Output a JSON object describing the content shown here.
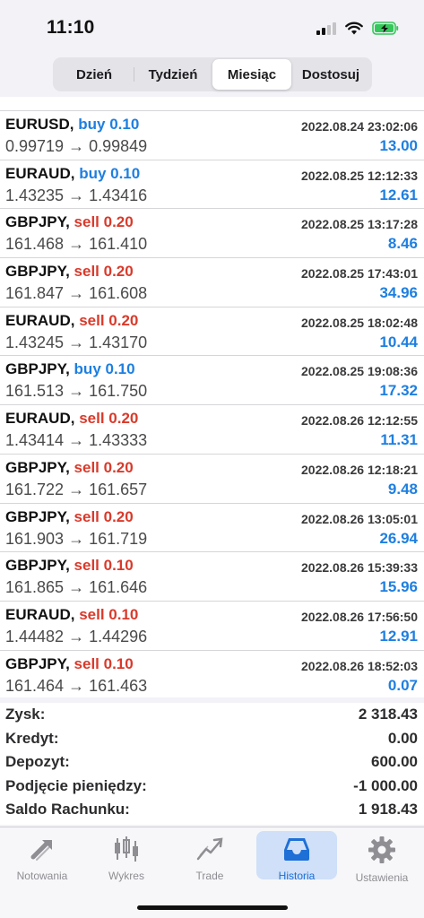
{
  "status": {
    "time": "11:10"
  },
  "period_tabs": [
    {
      "label": "Dzień",
      "active": false
    },
    {
      "label": "Tydzień",
      "active": false
    },
    {
      "label": "Miesiąc",
      "active": true
    },
    {
      "label": "Dostosuj",
      "active": false
    }
  ],
  "colors": {
    "buy": "#1e7fe0",
    "sell": "#d93a2b",
    "profit": "#1e7fe0",
    "tab_active_bg": "#cfe0f8"
  },
  "trades": [
    {
      "symbol": "EURUSD,",
      "side": "buy 0.10",
      "type": "buy",
      "date": "2022.08.24 23:02:06",
      "prices": "0.99719 → 0.99849",
      "profit": "13.00"
    },
    {
      "symbol": "EURAUD,",
      "side": "buy 0.10",
      "type": "buy",
      "date": "2022.08.25 12:12:33",
      "prices": "1.43235 → 1.43416",
      "profit": "12.61"
    },
    {
      "symbol": "GBPJPY,",
      "side": "sell 0.20",
      "type": "sell",
      "date": "2022.08.25 13:17:28",
      "prices": "161.468 → 161.410",
      "profit": "8.46"
    },
    {
      "symbol": "GBPJPY,",
      "side": "sell 0.20",
      "type": "sell",
      "date": "2022.08.25 17:43:01",
      "prices": "161.847 → 161.608",
      "profit": "34.96"
    },
    {
      "symbol": "EURAUD,",
      "side": "sell 0.20",
      "type": "sell",
      "date": "2022.08.25 18:02:48",
      "prices": "1.43245 → 1.43170",
      "profit": "10.44"
    },
    {
      "symbol": "GBPJPY,",
      "side": "buy 0.10",
      "type": "buy",
      "date": "2022.08.25 19:08:36",
      "prices": "161.513 → 161.750",
      "profit": "17.32"
    },
    {
      "symbol": "EURAUD,",
      "side": "sell 0.20",
      "type": "sell",
      "date": "2022.08.26 12:12:55",
      "prices": "1.43414 → 1.43333",
      "profit": "11.31"
    },
    {
      "symbol": "GBPJPY,",
      "side": "sell 0.20",
      "type": "sell",
      "date": "2022.08.26 12:18:21",
      "prices": "161.722 → 161.657",
      "profit": "9.48"
    },
    {
      "symbol": "GBPJPY,",
      "side": "sell 0.20",
      "type": "sell",
      "date": "2022.08.26 13:05:01",
      "prices": "161.903 → 161.719",
      "profit": "26.94"
    },
    {
      "symbol": "GBPJPY,",
      "side": "sell 0.10",
      "type": "sell",
      "date": "2022.08.26 15:39:33",
      "prices": "161.865 → 161.646",
      "profit": "15.96"
    },
    {
      "symbol": "EURAUD,",
      "side": "sell 0.10",
      "type": "sell",
      "date": "2022.08.26 17:56:50",
      "prices": "1.44482 → 1.44296",
      "profit": "12.91"
    },
    {
      "symbol": "GBPJPY,",
      "side": "sell 0.10",
      "type": "sell",
      "date": "2022.08.26 18:52:03",
      "prices": "161.464 → 161.463",
      "profit": "0.07"
    }
  ],
  "summary": [
    {
      "label": "Zysk:",
      "value": "2 318.43"
    },
    {
      "label": "Kredyt:",
      "value": "0.00"
    },
    {
      "label": "Depozyt:",
      "value": "600.00"
    },
    {
      "label": "Podjęcie pieniędzy:",
      "value": "-1 000.00"
    },
    {
      "label": "Saldo Rachunku:",
      "value": "1 918.43"
    }
  ],
  "tabbar": [
    {
      "label": "Notowania",
      "icon": "quotes-icon",
      "active": false
    },
    {
      "label": "Wykres",
      "icon": "candlestick-icon",
      "active": false
    },
    {
      "label": "Trade",
      "icon": "trade-icon",
      "active": false
    },
    {
      "label": "Historia",
      "icon": "history-inbox-icon",
      "active": true
    },
    {
      "label": "Ustawienia",
      "icon": "gear-icon",
      "active": false
    }
  ]
}
